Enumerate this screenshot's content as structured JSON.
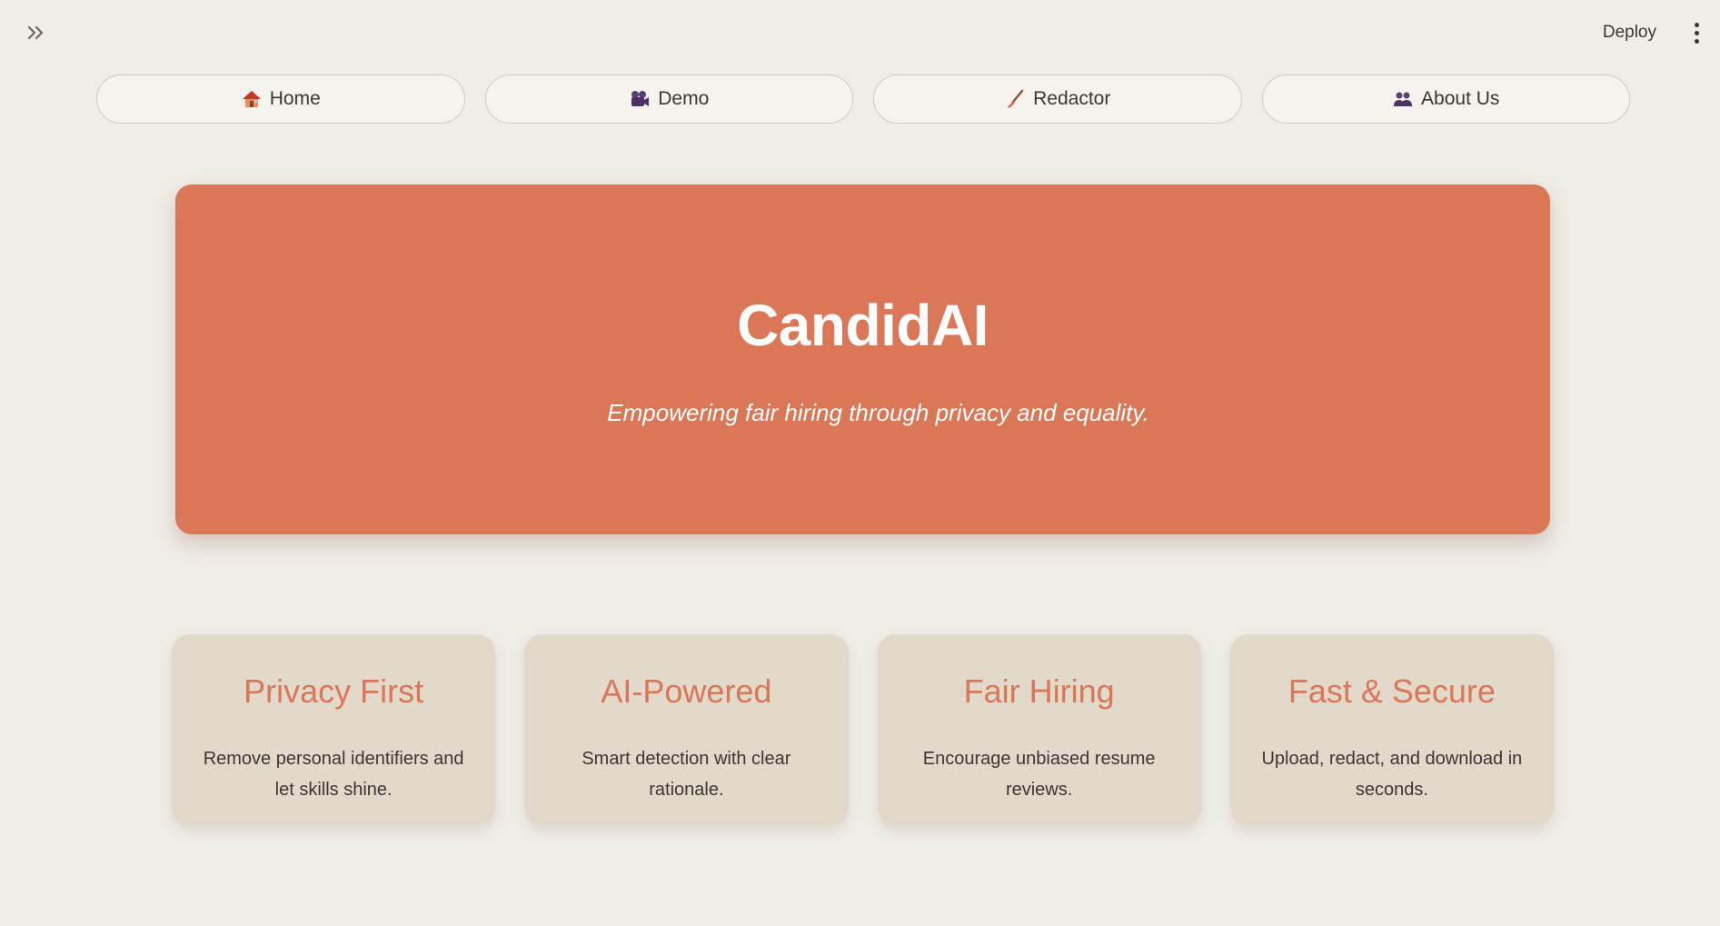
{
  "header": {
    "deploy_label": "Deploy"
  },
  "nav": {
    "items": [
      {
        "icon": "house-icon",
        "label": "Home"
      },
      {
        "icon": "video-camera-icon",
        "label": "Demo"
      },
      {
        "icon": "paintbrush-icon",
        "label": "Redactor"
      },
      {
        "icon": "people-icon",
        "label": "About Us"
      }
    ]
  },
  "hero": {
    "title": "CandidAI",
    "subtitle": "Empowering fair hiring through privacy and equality.",
    "background_color": "#d97757"
  },
  "features": [
    {
      "title": "Privacy First",
      "text": "Remove personal identifiers and let skills shine."
    },
    {
      "title": "AI-Powered",
      "text": "Smart detection with clear rationale."
    },
    {
      "title": "Fair Hiring",
      "text": "Encourage unbiased resume reviews."
    },
    {
      "title": "Fast & Secure",
      "text": "Upload, redact, and download in seconds."
    }
  ],
  "colors": {
    "accent": "#d97757",
    "page_background": "#f0ede7",
    "card_background": "#e3d9cb"
  }
}
